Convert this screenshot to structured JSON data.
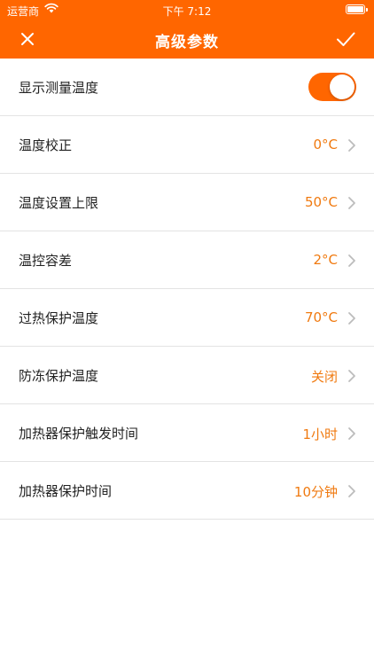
{
  "status_bar": {
    "carrier": "运营商",
    "time": "下午 7:12"
  },
  "nav": {
    "title": "高级参数",
    "close_icon": "close-icon",
    "confirm_icon": "checkmark-icon"
  },
  "colors": {
    "accent": "#ff6600",
    "value_text": "#f07a10",
    "divider": "#e3e3e3"
  },
  "settings": {
    "show_temp": {
      "label": "显示测量温度",
      "enabled": true
    },
    "items": [
      {
        "label": "温度校正",
        "value": "0°C"
      },
      {
        "label": "温度设置上限",
        "value": "50°C"
      },
      {
        "label": "温控容差",
        "value": "2°C"
      },
      {
        "label": "过热保护温度",
        "value": "70°C"
      },
      {
        "label": "防冻保护温度",
        "value": "关闭"
      },
      {
        "label": "加热器保护触发时间",
        "value": "1小时"
      },
      {
        "label": "加热器保护时间",
        "value": "10分钟"
      }
    ]
  }
}
